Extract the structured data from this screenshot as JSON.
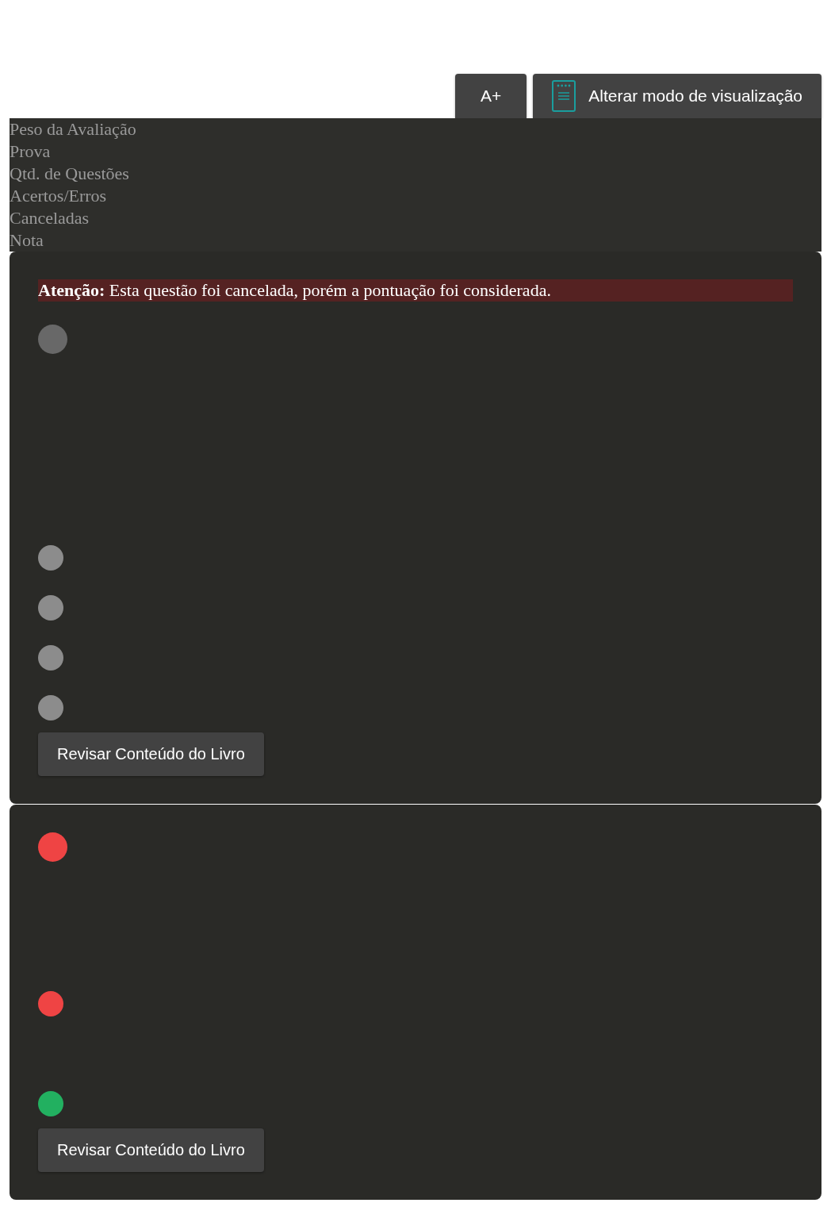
{
  "toolbar": {
    "font_button": "A+",
    "view_button": "Alterar modo de visualização"
  },
  "summary": {
    "labels": [
      "Peso da Avaliação",
      "Prova",
      "Qtd. de Questões",
      "Acertos/Erros",
      "Canceladas",
      "Nota"
    ]
  },
  "questions": [
    {
      "notice": "**Atenção:** Esta questão foi cancelada, porém a pontuação foi considerada.",
      "marker": {
        "color": "#686868"
      },
      "alternatives": [
        {
          "color": "#8c8c8c"
        },
        {
          "color": "#8c8c8c"
        },
        {
          "color": "#8c8c8c"
        },
        {
          "color": "#8c8c8c"
        }
      ],
      "review_button": "Revisar Conteúdo do Livro"
    },
    {
      "marker": {
        "color": "#ef4444"
      },
      "alternatives": [
        {
          "color": "#ef4444"
        },
        {
          "color": "#22b060"
        }
      ],
      "review_button": "Revisar Conteúdo do Livro"
    }
  ]
}
